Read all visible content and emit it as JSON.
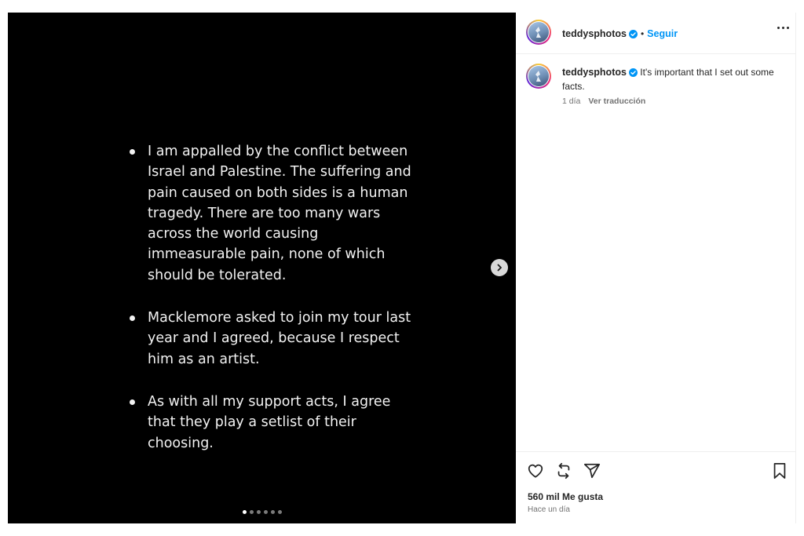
{
  "post": {
    "bullets": [
      "I am appalled by the conflict between Israel and Palestine. The suffering and pain caused on both sides is a human tragedy. There are too many wars across the world causing immeasurable pain, none of which should be tolerated.",
      "Macklemore asked to join my tour last year and I agreed, because I respect him as an artist.",
      "As with all my support acts, I agree that they play a setlist of their choosing."
    ],
    "carousel": {
      "slide_count": 6,
      "active_index": 0
    }
  },
  "header": {
    "username": "teddysphotos",
    "separator": "•",
    "follow_label": "Seguir",
    "more_icon": "more-horizontal-icon"
  },
  "caption": {
    "username": "teddysphotos",
    "text": "It's important that I set out some facts.",
    "time": "1 día",
    "translate_label": "Ver traducción"
  },
  "actions": {
    "icons": [
      "heart-icon",
      "repost-icon",
      "share-icon",
      "bookmark-icon"
    ],
    "likes": "560 mil Me gusta",
    "posted": "Hace un día"
  },
  "colors": {
    "accent": "#0095f6",
    "verified": "#0095f6",
    "text": "#262626",
    "muted": "#737373",
    "image_bg": "#000000"
  }
}
